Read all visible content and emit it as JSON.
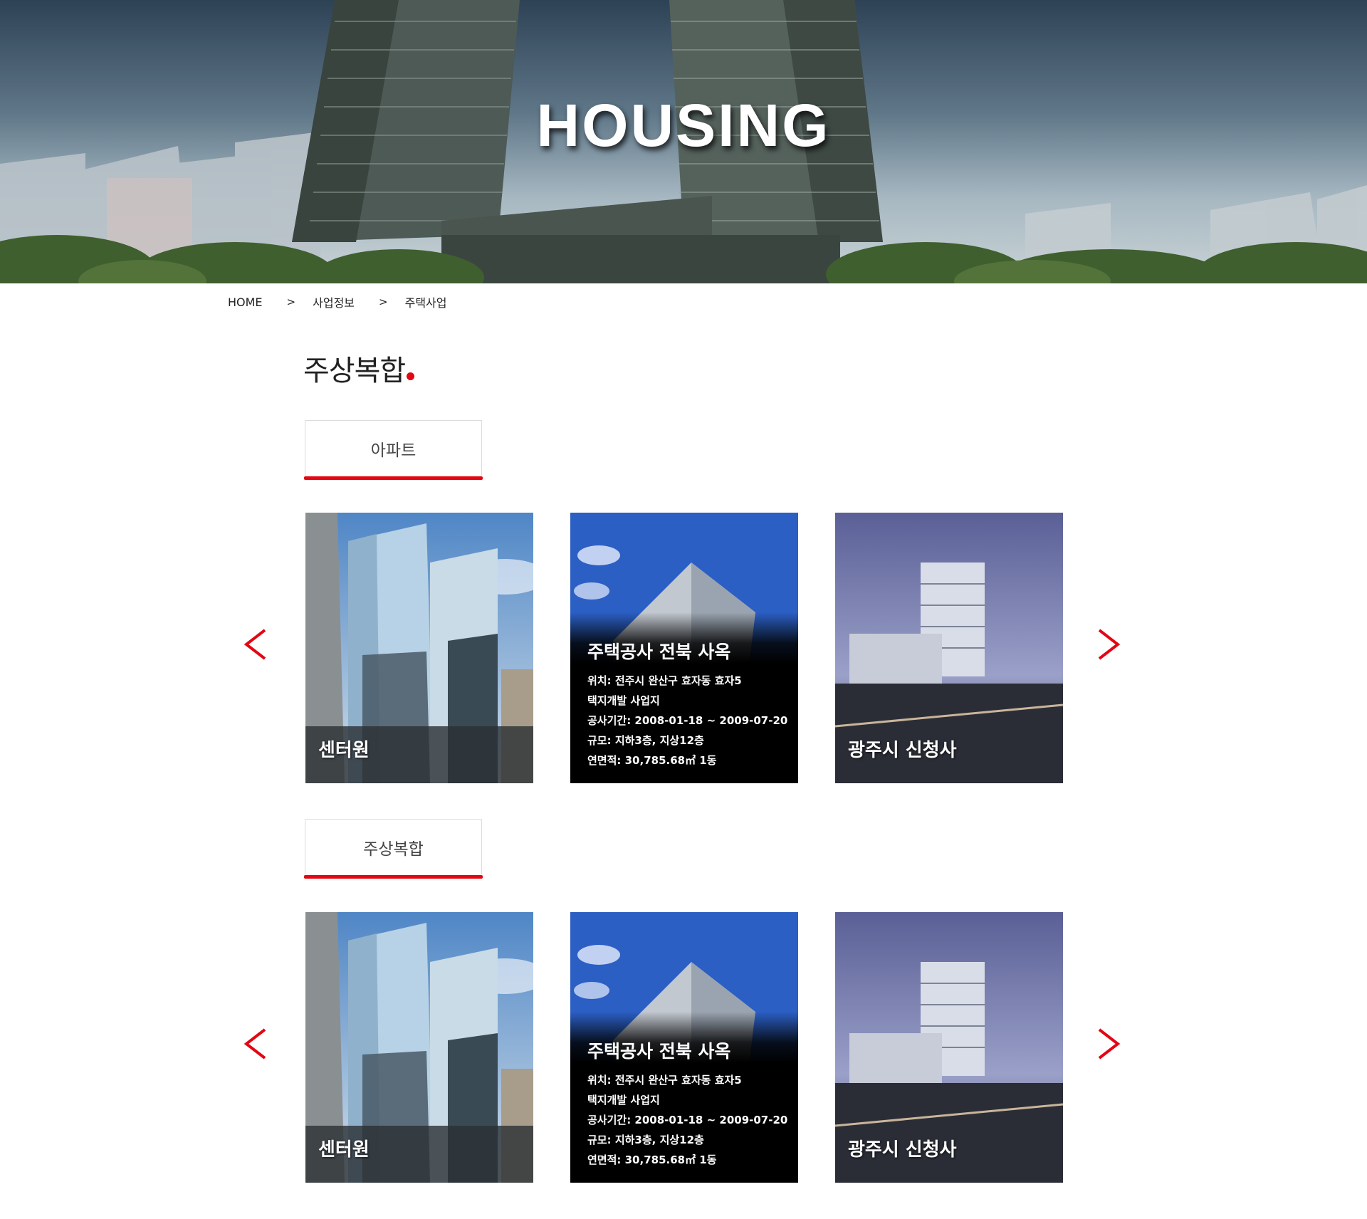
{
  "hero": {
    "title": "HOUSING"
  },
  "breadcrumb": {
    "home": "HOME",
    "sep": ">",
    "level1": "사업정보",
    "level2": "주택사업"
  },
  "page_title": "주상복합",
  "sections": [
    {
      "tab_label": "아파트",
      "cards": [
        {
          "name": "센터원"
        },
        {
          "name": "주택공사 전북 사옥",
          "details": [
            "위치: 전주시 완산구 효자동 효자5",
            "택지개발 사업지",
            "공사기간: 2008-01-18 ~ 2009-07-20",
            "규모: 지하3층, 지상12층",
            "연면적: 30,785.68㎡  1동"
          ]
        },
        {
          "name": "광주시 신청사"
        }
      ]
    },
    {
      "tab_label": "주상복합",
      "cards": [
        {
          "name": "센터원"
        },
        {
          "name": "주택공사 전북 사옥",
          "details": [
            "위치: 전주시 완산구 효자동 효자5",
            "택지개발 사업지",
            "공사기간: 2008-01-18 ~ 2009-07-20",
            "규모: 지하3층, 지상12층",
            "연면적: 30,785.68㎡  1동"
          ]
        },
        {
          "name": "광주시 신청사"
        }
      ]
    }
  ],
  "colors": {
    "accent": "#e30613",
    "text": "#222222",
    "tab_border": "#dcdcdc"
  },
  "icons": {
    "prev": "chevron-left-icon",
    "next": "chevron-right-icon"
  }
}
